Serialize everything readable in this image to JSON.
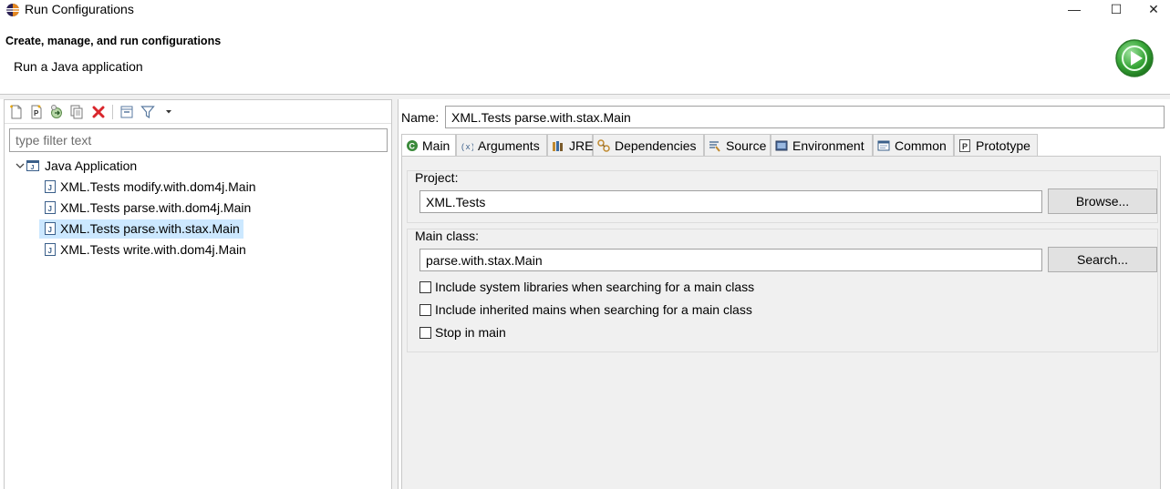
{
  "window": {
    "title": "Run Configurations",
    "minimize": "—",
    "maximize": "☐",
    "close": "✕"
  },
  "header": {
    "title": "Create, manage, and run configurations",
    "message": "Run a Java application"
  },
  "left": {
    "filter_placeholder": "type filter text",
    "toolbar": [
      "new-launch-configuration-icon",
      "new-prototype-icon",
      "export-icon",
      "duplicate-icon",
      "delete-icon",
      "collapse-all-icon",
      "filter-icon",
      "view-menu-icon"
    ],
    "tree": {
      "root": "Java Application",
      "items": [
        "XML.Tests modify.with.dom4j.Main",
        "XML.Tests parse.with.dom4j.Main",
        "XML.Tests parse.with.stax.Main",
        "XML.Tests write.with.dom4j.Main"
      ],
      "selected_index": 2
    }
  },
  "right": {
    "name_label": "Name:",
    "name_value": "XML.Tests parse.with.stax.Main",
    "tabs": [
      "Main",
      "Arguments",
      "JRE",
      "Dependencies",
      "Source",
      "Environment",
      "Common",
      "Prototype"
    ],
    "active_tab": "Main",
    "project_label": "Project:",
    "project_value": "XML.Tests",
    "browse_button": "Browse...",
    "main_class_label": "Main class:",
    "main_class_value": "parse.with.stax.Main",
    "search_button": "Search...",
    "checkboxes": [
      {
        "label": "Include system libraries when searching for a main class",
        "checked": false
      },
      {
        "label": "Include inherited mains when searching for a main class",
        "checked": false
      },
      {
        "label": "Stop in main",
        "checked": false
      }
    ]
  },
  "colors": {
    "selection": "#cce8ff",
    "run_green": "#3aa83a",
    "delete_red": "#d9262c"
  }
}
